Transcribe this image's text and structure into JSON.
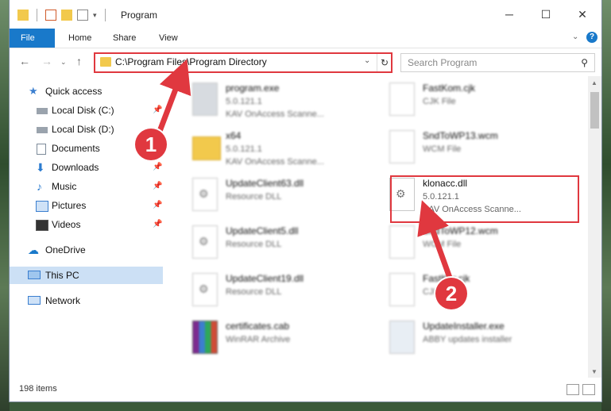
{
  "window": {
    "title": "Program",
    "controls": [
      "minimize",
      "maximize",
      "close"
    ]
  },
  "ribbon": {
    "tabs": [
      "File",
      "Home",
      "Share",
      "View"
    ]
  },
  "address_bar": {
    "path": "C:\\Program Files\\Program Directory"
  },
  "search": {
    "placeholder": "Search Program"
  },
  "sidebar": {
    "items": [
      {
        "label": "Quick access",
        "icon": "star-icon"
      },
      {
        "label": "Local Disk (C:)",
        "icon": "drive-icon",
        "pinned": true
      },
      {
        "label": "Local Disk (D:)",
        "icon": "drive-icon"
      },
      {
        "label": "Documents",
        "icon": "documents-icon",
        "pinned": true
      },
      {
        "label": "Downloads",
        "icon": "download-arrow-icon",
        "pinned": true
      },
      {
        "label": "Music",
        "icon": "music-note-icon",
        "pinned": true
      },
      {
        "label": "Pictures",
        "icon": "pictures-icon",
        "pinned": true
      },
      {
        "label": "Videos",
        "icon": "film-icon",
        "pinned": true
      },
      {
        "label": "OneDrive",
        "icon": "cloud-icon"
      },
      {
        "label": "This PC",
        "icon": "computer-icon",
        "selected": true
      },
      {
        "label": "Network",
        "icon": "network-icon"
      }
    ]
  },
  "files": [
    {
      "name": "program.exe",
      "line2": "5.0.121.1",
      "line3": "KAV OnAccess Scanne..."
    },
    {
      "name": "FastKom.cjk",
      "line2": "CJK File",
      "line3": ""
    },
    {
      "name": "x64",
      "line2": "5.0.121.1",
      "line3": "KAV OnAccess Scanne..."
    },
    {
      "name": "SndToWP13.wcm",
      "line2": "WCM File",
      "line3": ""
    },
    {
      "name": "UpdateClient63.dll",
      "line2": "Resource DLL",
      "line3": ""
    },
    {
      "name": "klonacc.dll",
      "line2": "5.0.121.1",
      "line3": "KAV OnAccess Scanne..."
    },
    {
      "name": "UpdateClient5.dll",
      "line2": "Resource DLL",
      "line3": ""
    },
    {
      "name": "SndToWP12.wcm",
      "line2": "WCM File",
      "line3": ""
    },
    {
      "name": "UpdateClient19.dll",
      "line2": "Resource DLL",
      "line3": ""
    },
    {
      "name": "FastKor.cjk",
      "line2": "CJK File",
      "line3": ""
    },
    {
      "name": "certificates.cab",
      "line2": "WinRAR Archive",
      "line3": ""
    },
    {
      "name": "UpdateInstaller.exe",
      "line2": "ABBY updates installer",
      "line3": ""
    }
  ],
  "status": {
    "item_count": "198 items"
  },
  "annotations": {
    "marker1": "1",
    "marker2": "2"
  },
  "colors": {
    "highlight": "#e0383f",
    "accent": "#1979ca",
    "selection": "#cce0f5"
  }
}
